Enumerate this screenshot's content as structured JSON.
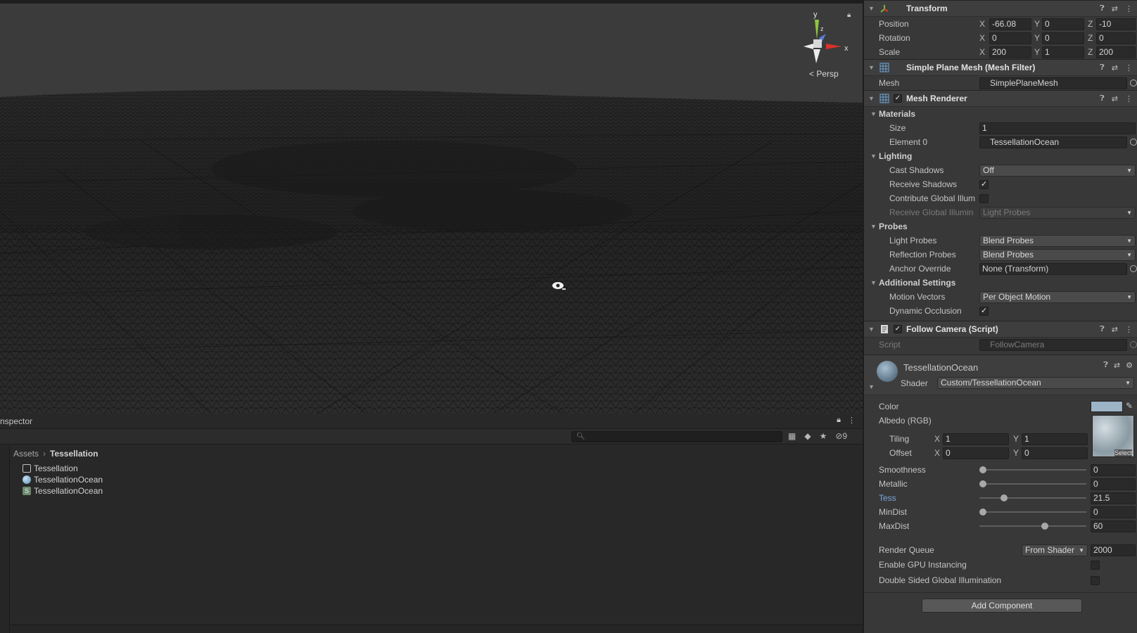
{
  "scene": {
    "persp_label": "Persp",
    "gizmo_axes": {
      "x": "x",
      "y": "y",
      "z": "z"
    }
  },
  "project": {
    "tab_label": "nspector",
    "search_placeholder": "",
    "hidden_count": "9",
    "breadcrumb": {
      "root": "Assets",
      "current": "Tessellation"
    },
    "assets": [
      {
        "name": "Tessellation",
        "icon": "scene-icon"
      },
      {
        "name": "TessellationOcean",
        "icon": "material-icon"
      },
      {
        "name": "TessellationOcean",
        "icon": "shader-icon"
      }
    ]
  },
  "inspector": {
    "transform": {
      "title": "Transform",
      "position": {
        "label": "Position",
        "x": "-66.08",
        "y": "0",
        "z": "-10"
      },
      "rotation": {
        "label": "Rotation",
        "x": "0",
        "y": "0",
        "z": "0"
      },
      "scale": {
        "label": "Scale",
        "x": "200",
        "y": "1",
        "z": "200"
      }
    },
    "mesh_filter": {
      "title": "Simple Plane Mesh (Mesh Filter)",
      "mesh_label": "Mesh",
      "mesh_value": "SimplePlaneMesh"
    },
    "mesh_renderer": {
      "title": "Mesh Renderer",
      "materials_label": "Materials",
      "size_label": "Size",
      "size_value": "1",
      "element0_label": "Element 0",
      "element0_value": "TessellationOcean",
      "lighting_label": "Lighting",
      "cast_shadows_label": "Cast Shadows",
      "cast_shadows_value": "Off",
      "receive_shadows_label": "Receive Shadows",
      "contribute_gi_label": "Contribute Global Illum",
      "receive_gi_label": "Receive Global Illumin",
      "receive_gi_value": "Light Probes",
      "probes_label": "Probes",
      "light_probes_label": "Light Probes",
      "light_probes_value": "Blend Probes",
      "reflection_probes_label": "Reflection Probes",
      "reflection_probes_value": "Blend Probes",
      "anchor_override_label": "Anchor Override",
      "anchor_override_value": "None (Transform)",
      "additional_label": "Additional Settings",
      "motion_vectors_label": "Motion Vectors",
      "motion_vectors_value": "Per Object Motion",
      "dynamic_occlusion_label": "Dynamic Occlusion"
    },
    "follow_camera": {
      "title": "Follow Camera (Script)",
      "script_label": "Script",
      "script_value": "FollowCamera"
    },
    "material": {
      "name": "TessellationOcean",
      "shader_label": "Shader",
      "shader_value": "Custom/TessellationOcean",
      "color_label": "Color",
      "color_swatch": "#9db4c6",
      "albedo_label": "Albedo (RGB)",
      "select_label": "Select",
      "tiling_label": "Tiling",
      "tiling_x": "1",
      "tiling_y": "1",
      "offset_label": "Offset",
      "offset_x": "0",
      "offset_y": "0",
      "smoothness_label": "Smoothness",
      "smoothness_value": "0",
      "metallic_label": "Metallic",
      "metallic_value": "0",
      "tess_label": "Tess",
      "tess_value": "21.5",
      "mindist_label": "MinDist",
      "mindist_value": "0",
      "maxdist_label": "MaxDist",
      "maxdist_value": "60",
      "render_queue_label": "Render Queue",
      "render_queue_mode": "From Shader",
      "render_queue_value": "2000",
      "gpu_instancing_label": "Enable GPU Instancing",
      "double_sided_gi_label": "Double Sided Global Illumination"
    },
    "add_component_label": "Add Component"
  }
}
